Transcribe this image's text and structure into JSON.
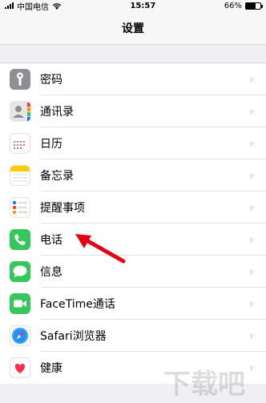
{
  "status_bar": {
    "carrier": "中国电信",
    "time": "15:57",
    "battery": "66%",
    "battery_level": 0.66
  },
  "nav": {
    "title": "设置"
  },
  "settings": [
    {
      "label": "密码",
      "icon": "passcode-key-icon",
      "color": "#8e8e93"
    },
    {
      "label": "通讯录",
      "icon": "contacts-icon",
      "color": "#c8c7cc"
    },
    {
      "label": "日历",
      "icon": "calendar-icon",
      "color": "#ffffff"
    },
    {
      "label": "备忘录",
      "icon": "notes-icon",
      "color": "#ffcc00"
    },
    {
      "label": "提醒事项",
      "icon": "reminders-icon",
      "color": "#ffffff"
    },
    {
      "label": "电话",
      "icon": "phone-icon",
      "color": "#34c759"
    },
    {
      "label": "信息",
      "icon": "messages-icon",
      "color": "#34c759"
    },
    {
      "label": "FaceTime通话",
      "icon": "facetime-icon",
      "color": "#34c759"
    },
    {
      "label": "Safari浏览器",
      "icon": "safari-icon",
      "color": "#1e90ff"
    },
    {
      "label": "健康",
      "icon": "health-icon",
      "color": "#ff2d55"
    }
  ],
  "annotation": {
    "arrow_color": "#e60012",
    "target": "电话"
  },
  "watermark": {
    "text": "下载吧"
  }
}
